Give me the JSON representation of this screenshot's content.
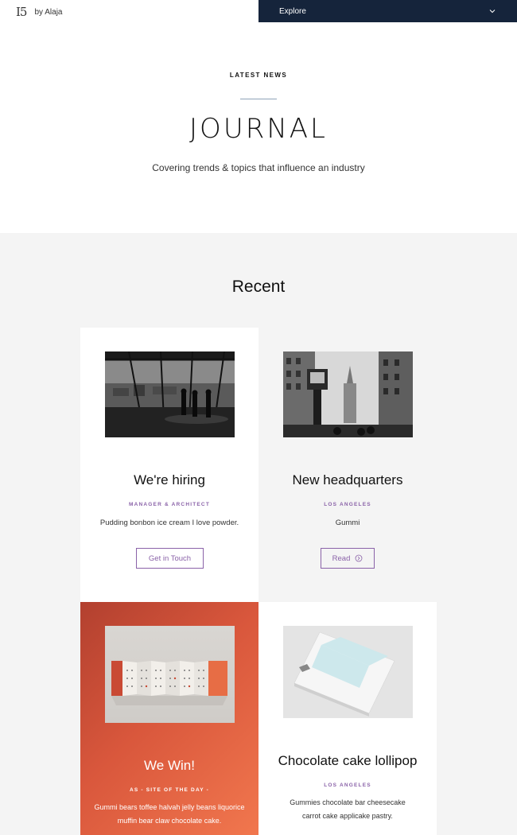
{
  "header": {
    "logo": "I5",
    "brand": "by Alaja",
    "explore": "Explore"
  },
  "hero": {
    "eyebrow": "LATEST NEWS",
    "title": "JOURNAL",
    "subtitle": "Covering trends & topics that influence an industry"
  },
  "recent": {
    "title": "Recent",
    "cards": [
      {
        "title": "We're hiring",
        "tag": "MANAGER & ARCHITECT",
        "desc": "Pudding bonbon ice cream I love powder.",
        "button": "Get in Touch"
      },
      {
        "title": "New headquarters",
        "tag": "LOS ANGELES",
        "desc": "Gummi",
        "button": "Read"
      },
      {
        "title": "We Win!",
        "tag": "AS - SITE OF THE DAY -",
        "desc": "Gummi bears toffee halvah jelly beans liquorice muffin bear claw chocolate cake."
      },
      {
        "title": "Chocolate cake lollipop",
        "tag": "LOS ANGELES",
        "desc": "Gummies chocolate bar cheesecake carrot cake applicake pastry."
      }
    ]
  },
  "colors": {
    "navy": "#15243b",
    "accent": "#8a62a8",
    "section_bg": "#f4f4f4",
    "orange_start": "#b2402f",
    "orange_end": "#f1774e"
  },
  "icons": [
    "chevron-down-icon",
    "arrow-circle-icon"
  ]
}
